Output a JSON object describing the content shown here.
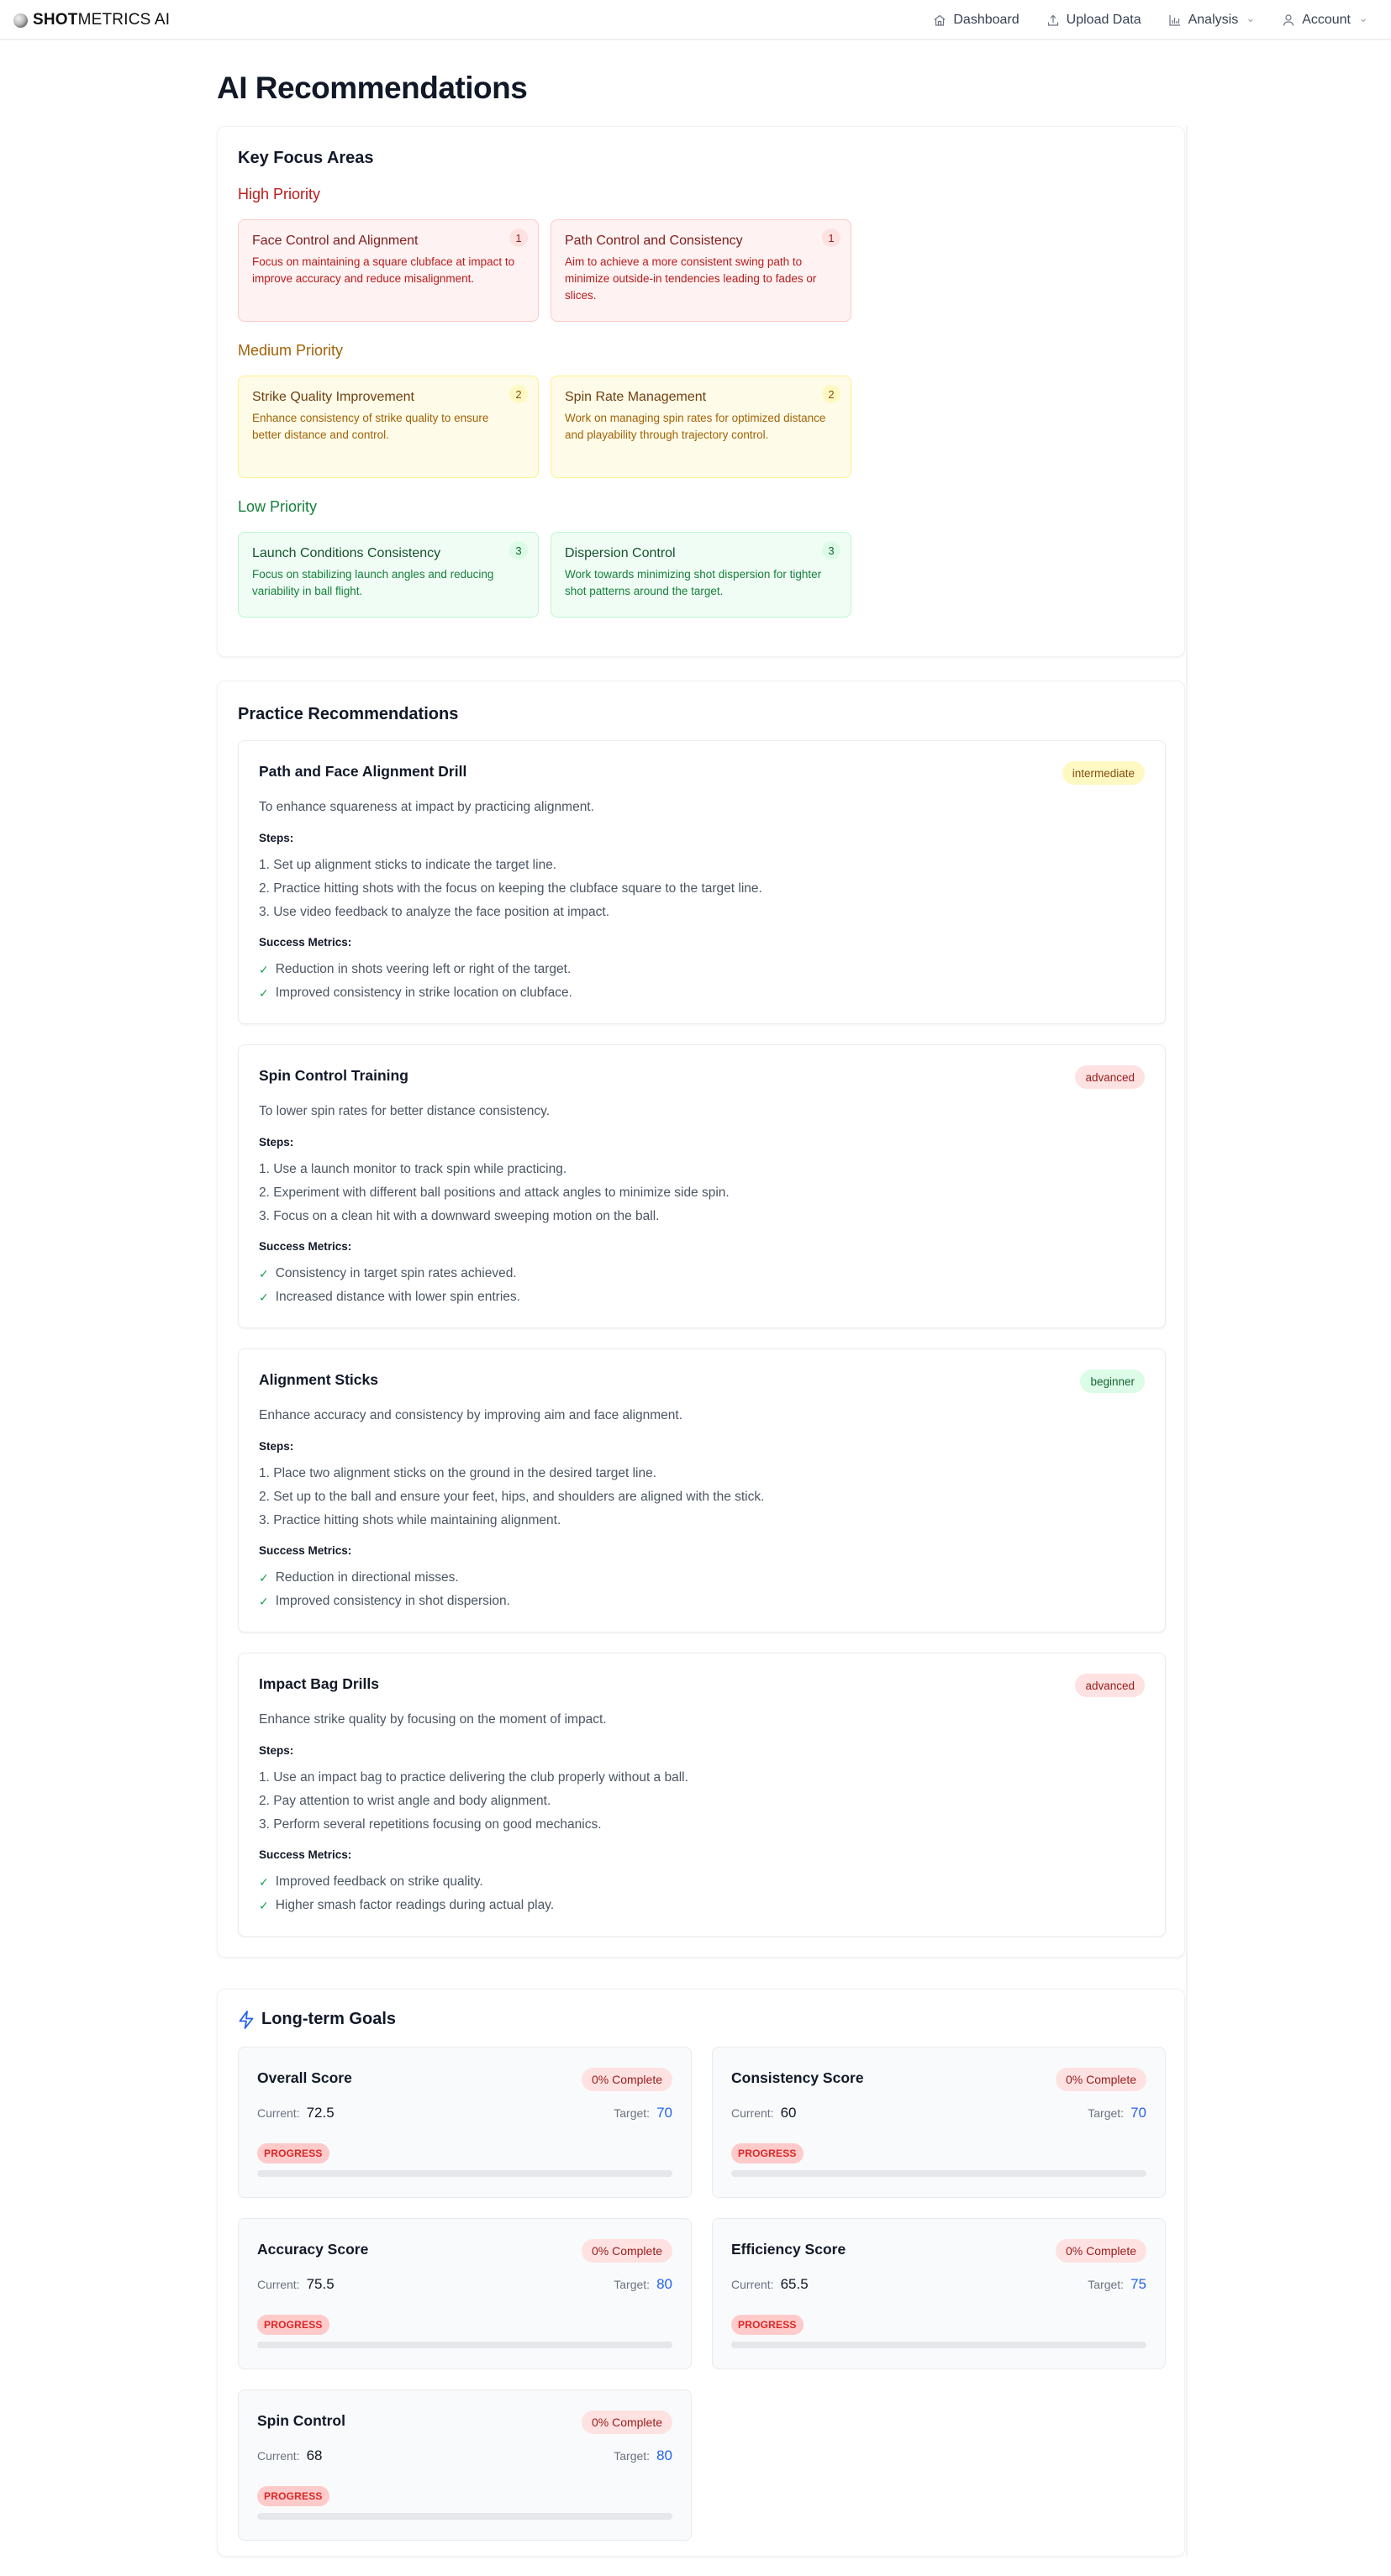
{
  "app": {
    "brand_bold": "SHOT",
    "brand_light": "METRICS AI",
    "nav": [
      {
        "label": "Dashboard",
        "icon": "home-icon",
        "dropdown": false
      },
      {
        "label": "Upload Data",
        "icon": "upload-icon",
        "dropdown": false
      },
      {
        "label": "Analysis",
        "icon": "bar-chart-icon",
        "dropdown": true
      },
      {
        "label": "Account",
        "icon": "user-icon",
        "dropdown": true
      }
    ]
  },
  "page": {
    "title": "AI Recommendations"
  },
  "focus": {
    "heading": "Key Focus Areas",
    "groups": [
      {
        "label": "High Priority",
        "level": "high",
        "items": [
          {
            "title": "Face Control and Alignment",
            "desc": "Focus on maintaining a square clubface at impact to improve accuracy and reduce misalignment.",
            "rank": "1"
          },
          {
            "title": "Path Control and Consistency",
            "desc": "Aim to achieve a more consistent swing path to minimize outside-in tendencies leading to fades or slices.",
            "rank": "1"
          }
        ]
      },
      {
        "label": "Medium Priority",
        "level": "med",
        "items": [
          {
            "title": "Strike Quality Improvement",
            "desc": "Enhance consistency of strike quality to ensure better distance and control.",
            "rank": "2"
          },
          {
            "title": "Spin Rate Management",
            "desc": "Work on managing spin rates for optimized distance and playability through trajectory control.",
            "rank": "2"
          }
        ]
      },
      {
        "label": "Low Priority",
        "level": "low",
        "items": [
          {
            "title": "Launch Conditions Consistency",
            "desc": "Focus on stabilizing launch angles and reducing variability in ball flight.",
            "rank": "3"
          },
          {
            "title": "Dispersion Control",
            "desc": "Work towards minimizing shot dispersion for tighter shot patterns around the target.",
            "rank": "3"
          }
        ]
      }
    ]
  },
  "practice": {
    "heading": "Practice Recommendations",
    "steps_label": "Steps:",
    "metrics_label": "Success Metrics:",
    "drills": [
      {
        "title": "Path and Face Alignment Drill",
        "level": "intermediate",
        "desc": "To enhance squareness at impact by practicing alignment.",
        "steps": [
          "1. Set up alignment sticks to indicate the target line.",
          "2. Practice hitting shots with the focus on keeping the clubface square to the target line.",
          "3. Use video feedback to analyze the face position at impact."
        ],
        "metrics": [
          "Reduction in shots veering left or right of the target.",
          "Improved consistency in strike location on clubface."
        ]
      },
      {
        "title": "Spin Control Training",
        "level": "advanced",
        "desc": "To lower spin rates for better distance consistency.",
        "steps": [
          "1. Use a launch monitor to track spin while practicing.",
          "2. Experiment with different ball positions and attack angles to minimize side spin.",
          "3. Focus on a clean hit with a downward sweeping motion on the ball."
        ],
        "metrics": [
          "Consistency in target spin rates achieved.",
          "Increased distance with lower spin entries."
        ]
      },
      {
        "title": "Alignment Sticks",
        "level": "beginner",
        "desc": "Enhance accuracy and consistency by improving aim and face alignment.",
        "steps": [
          "1. Place two alignment sticks on the ground in the desired target line.",
          "2. Set up to the ball and ensure your feet, hips, and shoulders are aligned with the stick.",
          "3. Practice hitting shots while maintaining alignment."
        ],
        "metrics": [
          "Reduction in directional misses.",
          "Improved consistency in shot dispersion."
        ]
      },
      {
        "title": "Impact Bag Drills",
        "level": "advanced",
        "desc": "Enhance strike quality by focusing on the moment of impact.",
        "steps": [
          "1. Use an impact bag to practice delivering the club properly without a ball.",
          "2. Pay attention to wrist angle and body alignment.",
          "3. Perform several repetitions focusing on good mechanics."
        ],
        "metrics": [
          "Improved feedback on strike quality.",
          "Higher smash factor readings during actual play."
        ]
      }
    ]
  },
  "goals": {
    "heading": "Long-term Goals",
    "current_label": "Current:",
    "target_label": "Target:",
    "progress_label": "PROGRESS",
    "items": [
      {
        "name": "Overall Score",
        "complete": "0% Complete",
        "current": "72.5",
        "target": "70",
        "progress_pct": 0
      },
      {
        "name": "Consistency Score",
        "complete": "0% Complete",
        "current": "60",
        "target": "70",
        "progress_pct": 0
      },
      {
        "name": "Accuracy Score",
        "complete": "0% Complete",
        "current": "75.5",
        "target": "80",
        "progress_pct": 0
      },
      {
        "name": "Efficiency Score",
        "complete": "0% Complete",
        "current": "65.5",
        "target": "75",
        "progress_pct": 0
      },
      {
        "name": "Spin Control",
        "complete": "0% Complete",
        "current": "68",
        "target": "80",
        "progress_pct": 0
      }
    ]
  },
  "colors": {
    "high": "#b91c1c",
    "medium": "#a16207",
    "low": "#15803d",
    "accent": "#2563eb"
  }
}
